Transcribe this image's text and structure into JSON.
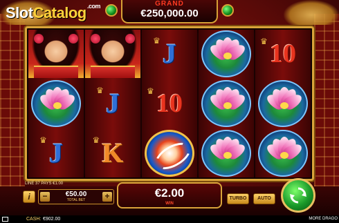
{
  "logo": {
    "slot": "Slot",
    "catalog": "Catalog",
    "com": ".com"
  },
  "jackpot": {
    "label": "GRAND",
    "amount": "€250,000.00"
  },
  "reels": [
    [
      "woman",
      "lotus",
      "J"
    ],
    [
      "woman",
      "J",
      "K"
    ],
    [
      "J",
      "10",
      "koi"
    ],
    [
      "lotus",
      "lotus",
      "lotus"
    ],
    [
      "10",
      "lotus",
      "lotus"
    ]
  ],
  "line_info": "LINE 37 PAYS €1.00",
  "bet": {
    "value": "€50.00",
    "label": "TOTAL BET",
    "minus": "−",
    "plus": "+"
  },
  "win": {
    "value": "€2.00",
    "label": "WIN"
  },
  "buttons": {
    "info": "i",
    "turbo": "TURBO",
    "auto": "AUTO"
  },
  "status": {
    "cash_label": "CASH:",
    "cash_value": "€902.00",
    "more": "MORE DRAGO"
  },
  "colors": {
    "gold": "#d9a43a",
    "spin_green": "#1a9a2a",
    "jackpot_red": "#ff3a22"
  }
}
